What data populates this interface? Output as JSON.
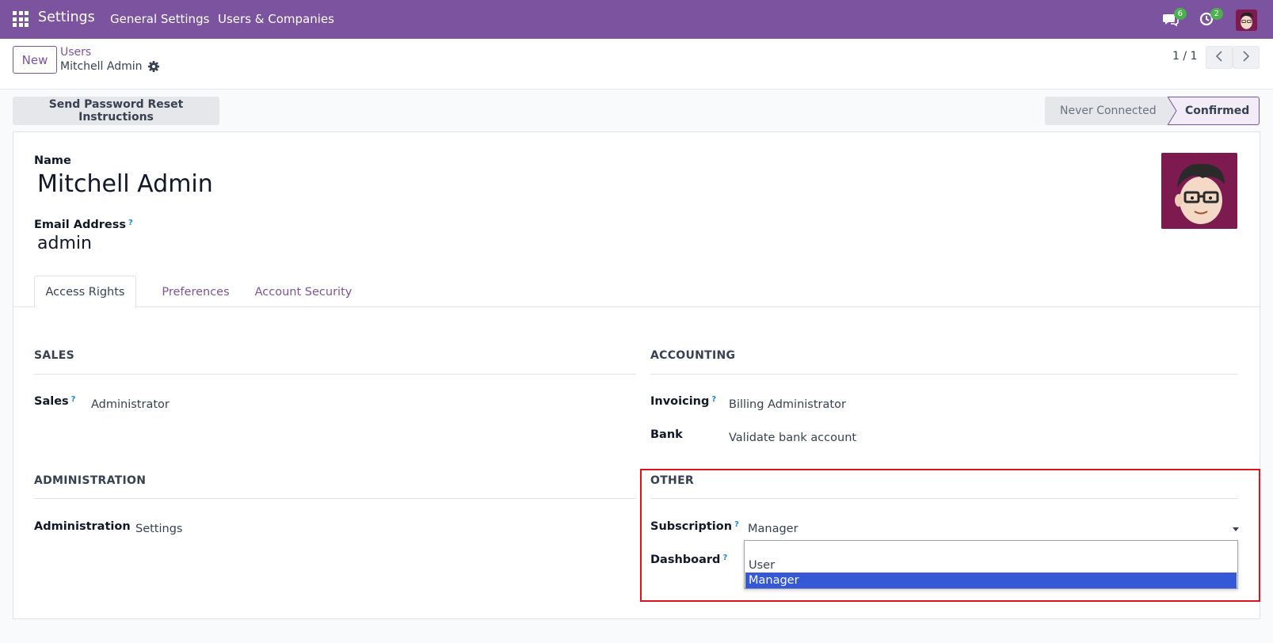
{
  "topbar": {
    "brand": "Settings",
    "nav": [
      "General Settings",
      "Users & Companies"
    ],
    "messages_count": "6",
    "activities_count": "2"
  },
  "control_panel": {
    "new_label": "New",
    "breadcrumb_parent": "Users",
    "breadcrumb_current": "Mitchell Admin",
    "pager": "1 / 1"
  },
  "status_bar": {
    "reset_label": "Send Password Reset Instructions",
    "stages": [
      "Never Connected",
      "Confirmed"
    ],
    "current_stage": "Confirmed"
  },
  "form": {
    "name_label": "Name",
    "name_value": "Mitchell Admin",
    "email_label": "Email Address",
    "email_help": "?",
    "email_value": "admin"
  },
  "tabs": [
    "Access Rights",
    "Preferences",
    "Account Security"
  ],
  "sections": {
    "sales": {
      "title": "SALES",
      "fields": [
        {
          "label": "Sales",
          "help": "?",
          "value": "Administrator"
        }
      ]
    },
    "accounting": {
      "title": "ACCOUNTING",
      "fields": [
        {
          "label": "Invoicing",
          "help": "?",
          "value": "Billing Administrator"
        },
        {
          "label": "Bank",
          "value": "Validate bank account"
        }
      ]
    },
    "administration": {
      "title": "ADMINISTRATION",
      "fields": [
        {
          "label": "Administration",
          "value": "Settings"
        }
      ]
    },
    "other": {
      "title": "OTHER",
      "fields": [
        {
          "label": "Subscription",
          "help": "?",
          "value": "Manager"
        },
        {
          "label": "Dashboard",
          "help": "?",
          "value": ""
        }
      ]
    }
  },
  "dropdown": {
    "options": [
      "",
      "User",
      "Manager"
    ],
    "selected": "Manager"
  },
  "colors": {
    "brand": "#7b539e",
    "highlight": "#e1111f",
    "selected_option": "#3558d6"
  }
}
